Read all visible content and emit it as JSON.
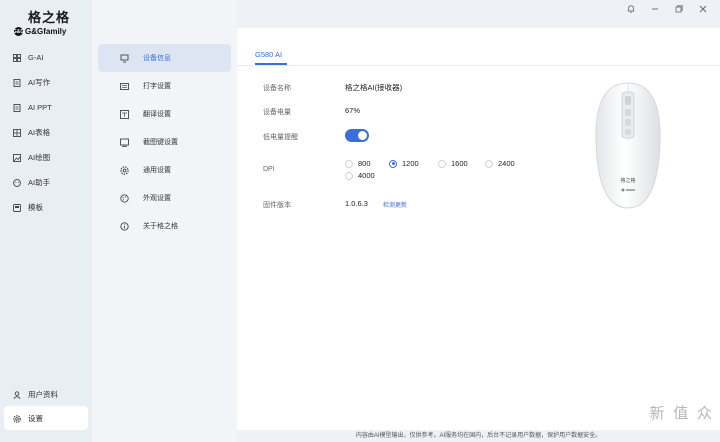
{
  "brand": {
    "name_cn": "格之格",
    "name_en": "G&Gfamily",
    "logo_letters": "G&G"
  },
  "nav": {
    "items": [
      {
        "label": "G-AI",
        "icon": "grid-icon"
      },
      {
        "label": "AI写作",
        "icon": "document-icon"
      },
      {
        "label": "AI PPT",
        "icon": "document-icon"
      },
      {
        "label": "AI表格",
        "icon": "table-icon"
      },
      {
        "label": "AI绘图",
        "icon": "image-icon"
      },
      {
        "label": "AI助手",
        "icon": "assistant-icon"
      },
      {
        "label": "模板",
        "icon": "template-icon"
      }
    ],
    "user_label": "用户资料",
    "settings_label": "设置"
  },
  "submenu": {
    "items": [
      {
        "label": "设备信息",
        "icon": "device-icon",
        "active": true
      },
      {
        "label": "打字设置",
        "icon": "keyboard-icon"
      },
      {
        "label": "翻译设置",
        "icon": "translate-icon"
      },
      {
        "label": "截图键设置",
        "icon": "screenshot-icon"
      },
      {
        "label": "通用设置",
        "icon": "gear-icon"
      },
      {
        "label": "外观设置",
        "icon": "palette-icon"
      },
      {
        "label": "关于格之格",
        "icon": "info-icon"
      }
    ]
  },
  "device": {
    "tab": "G580 AI",
    "name_label": "设备名称",
    "name_value": "格之格AI(接收器)",
    "battery_label": "设备电量",
    "battery_value": "67%",
    "low_battery_label": "低电量提醒",
    "low_battery_on": true,
    "dpi_label": "DPI",
    "dpi_options": [
      "800",
      "1200",
      "1600",
      "2400",
      "4000"
    ],
    "dpi_selected": "1200",
    "firmware_label": "固件版本",
    "firmware_value": "1.0.6.3",
    "check_update": "检测更新",
    "mouse_brand": "格之格"
  },
  "footer": "内容由AI模型输出，仅供参考。AI服务均在国内，后台不记录用户数据，保护用户数据安全。",
  "watermark": "新 值 众",
  "colors": {
    "accent": "#3b6fd8"
  }
}
